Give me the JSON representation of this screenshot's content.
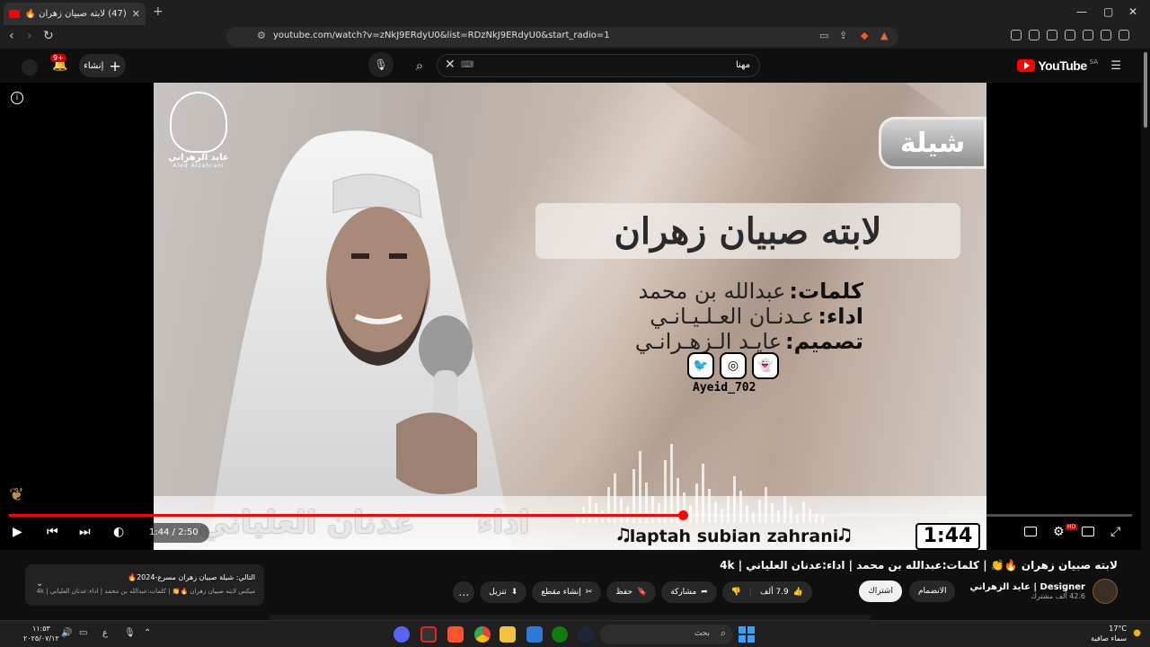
{
  "browser": {
    "tab_title": "(47) لابته صبيان زهران 🔥👏 | كلمات",
    "tab_close": "✕",
    "new_tab": "+",
    "url": "youtube.com/watch?v=zNkJ9ERdyU0&list=RDzNkJ9ERdyU0&start_radio=1",
    "window_controls": [
      "—",
      "▢",
      "✕"
    ]
  },
  "yt_header": {
    "logo_text": "YouTube",
    "country": "SA",
    "search_query": "مهنا",
    "create_label": "إنشاء",
    "notif_badge": "9+"
  },
  "video_frame": {
    "logo_name_ar": "عايد الزهراني",
    "logo_name_en": "Aled Alzahrani",
    "tag": "شيلة",
    "art_title": "لابته صبيان زهران",
    "credits": [
      {
        "k": "كلمات:",
        "v": "عبدالله بن محمد"
      },
      {
        "k": "اداء:",
        "v": "عـدنـان العـلـيـانـي"
      },
      {
        "k": "تصميم:",
        "v": "عايـد الـزهـرانـي"
      }
    ],
    "social_handle": "Ayeid_702",
    "performer_label": "اداء",
    "performer_name": "عدنان العلياني",
    "song_en": "🎝laptah subian zahrani🎝",
    "time_overlay": "1:44"
  },
  "player": {
    "time_display": "1:44 / 2:50",
    "progress_fraction": 0.6,
    "buffered_fraction": 0.7
  },
  "video_info": {
    "title": "لابته صبيان زهران 🔥👏 | كلمات:عبدالله بن محمد | اداء:عدنان العلياني | 4k",
    "channel_name": "Designer | عايد الزهراني",
    "subscribers": "42.6 ألف مشترك",
    "join_label": "الانضمام",
    "subscribe_label": "اشتراك",
    "like_count": "7.9 ألف",
    "share_label": "مشاركة",
    "save_label": "حفظ",
    "clip_label": "إنشاء مقطع",
    "download_label": "تنزيل",
    "more_label": "…"
  },
  "up_next": {
    "line1": "التالي: شيلة صبيان زهران مسرع-2024🔥",
    "line2": "ميكس لابته صبيان زهران 🔥👏 | كلمات:عبدالله بن محمد | اداء:عدنان العلياني | 4k"
  },
  "taskbar": {
    "search_placeholder": "بحث",
    "time": "١١:٥٣",
    "date": "٢٠٢٥/٠٧/١٢",
    "lang": "ع",
    "temperature": "17°C",
    "weather_desc": "سماء صافية"
  },
  "colors": {
    "accent": "#ff0000",
    "background": "#0f0f0f"
  }
}
